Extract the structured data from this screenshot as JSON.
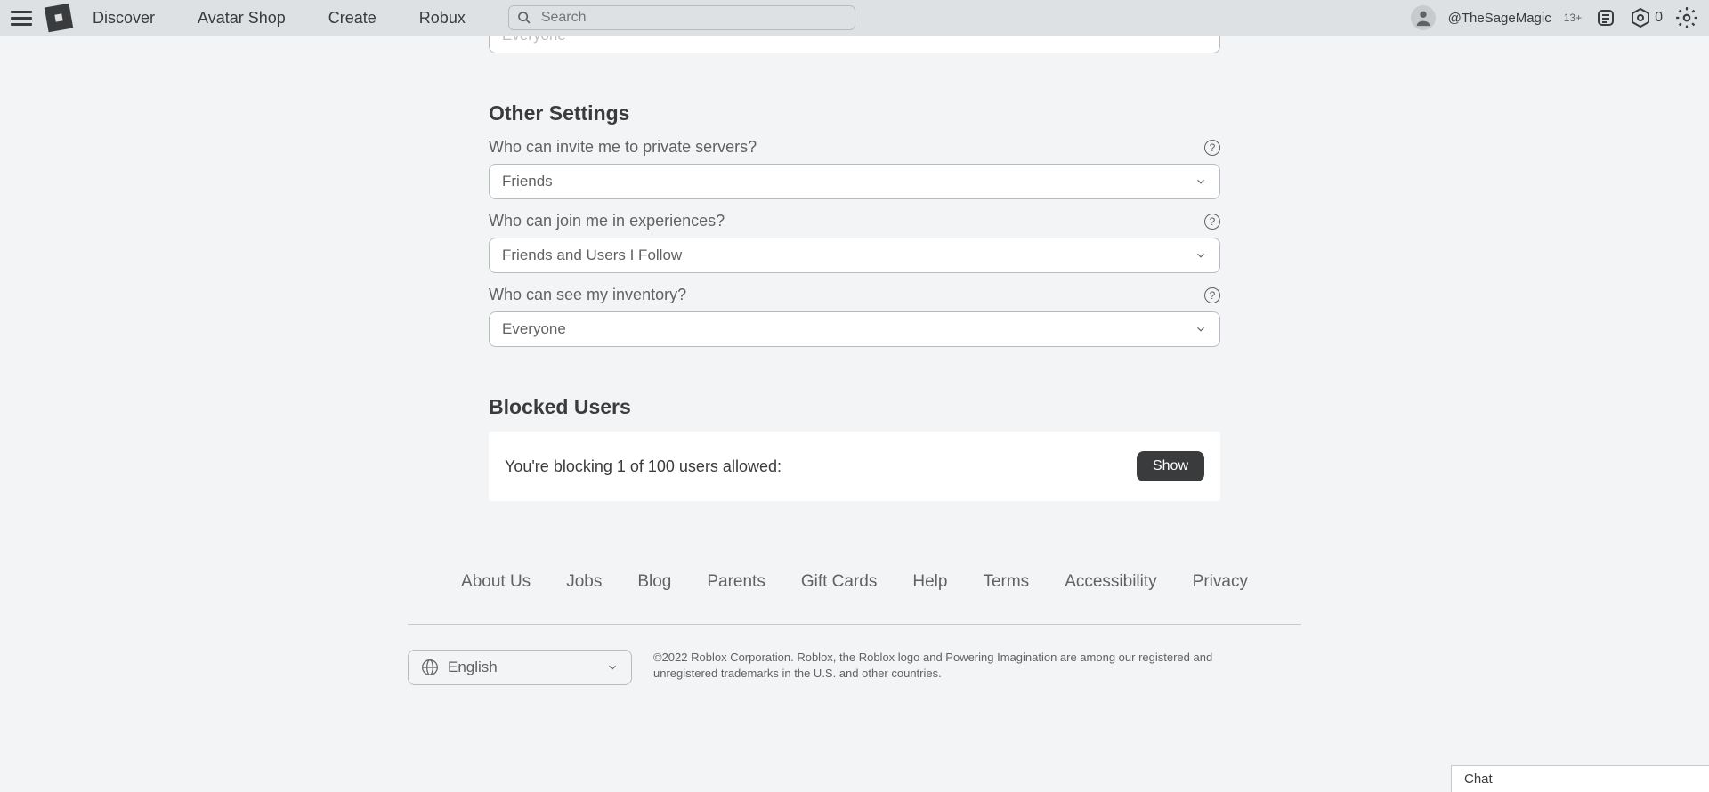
{
  "header": {
    "nav": [
      "Discover",
      "Avatar Shop",
      "Create",
      "Robux"
    ],
    "search_placeholder": "Search",
    "username": "@TheSageMagic",
    "age_badge": "13+",
    "robux_count": "0"
  },
  "top_select_partial": "Everyone",
  "sections": {
    "other_settings": {
      "title": "Other Settings",
      "rows": [
        {
          "label": "Who can invite me to private servers?",
          "value": "Friends"
        },
        {
          "label": "Who can join me in experiences?",
          "value": "Friends and Users I Follow"
        },
        {
          "label": "Who can see my inventory?",
          "value": "Everyone"
        }
      ]
    },
    "blocked_users": {
      "title": "Blocked Users",
      "text": "You're blocking 1 of 100 users allowed:",
      "button": "Show"
    }
  },
  "footer": {
    "links": [
      "About Us",
      "Jobs",
      "Blog",
      "Parents",
      "Gift Cards",
      "Help",
      "Terms",
      "Accessibility",
      "Privacy"
    ],
    "language": "English",
    "copyright": "©2022 Roblox Corporation. Roblox, the Roblox logo and Powering Imagination are among our registered and unregistered trademarks in the U.S. and other countries."
  },
  "chat": {
    "label": "Chat"
  }
}
